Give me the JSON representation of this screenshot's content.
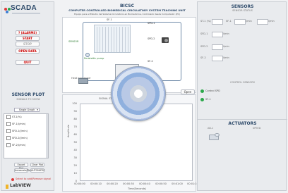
{
  "app": {
    "logo_text": "SCADA",
    "title_short": "BICSC",
    "title_main": "COMPUTER CONTROLLED BIOMEDICAL CIRCULATORY SYSTEM TEACHING UNIT",
    "title_sub": "Equipo para el Estudio del Sistema Circulatorio en Biomedicina, Controlado desde Computador (PC)"
  },
  "left_panel": {
    "buttons": [
      "? (ALARMS)",
      "START",
      "STOP",
      "OPEN DATA",
      "QUIT"
    ],
    "sensor_plot_title": "SENSOR PLOT",
    "sensor_plot_sub": "SIGNALS TO SHOW",
    "select_value": "Single Graph",
    "legend": [
      "ST-1(%)",
      "SF-1(l/min)",
      "SFD-1(l/min)",
      "SFD-2(l/min)",
      "SF-2(l/min)"
    ],
    "bottom_buttons": [
      "Export Plot",
      "Clear Plot",
      "Autoscale/Plot",
      "AUTOMATIC"
    ],
    "status_text": "Select to add/Remove signal",
    "labview_logo": "LabVIEW"
  },
  "diagram": {
    "labels": [
      "SF-1",
      "SENSOR",
      "SPD-1",
      "SPD-2",
      "Peristaltic pump",
      "Heat exchanger",
      "SF-2"
    ],
    "open_button": "Open"
  },
  "plot": {
    "title": "SIGNAL ST-1(%)",
    "ylabel": "Amplitude",
    "xlabel": "Time(Seconds)",
    "y_ticks": [
      "100",
      "90",
      "80",
      "70",
      "60",
      "50",
      "40",
      "30",
      "20",
      "10",
      "0"
    ],
    "x_ticks": [
      "00:00:00",
      "00:00:10",
      "00:00:20",
      "00:00:30",
      "00:00:40",
      "00:00:50",
      "00:01:00",
      "00:01:10"
    ]
  },
  "right_panel": {
    "sensors_title": "SENSORS",
    "sensors_sub": "SENSOR STATUS",
    "sensor_rows": [
      {
        "a": "ST-1 (%)",
        "b": "SF-1",
        "c": "l/min",
        "d": "l/min"
      },
      {
        "a": "SFD-1",
        "b": "l/min"
      },
      {
        "a": "SFD-2",
        "b": "l/min"
      },
      {
        "a": "SF-2",
        "b": "l/min"
      }
    ],
    "control_title": "CONTROL SENSORS",
    "control_items": [
      "Control SPD",
      "SF-1"
    ],
    "actuators_title": "ACTUATORS",
    "actuators_sub": [
      "AB-1",
      "SPEED"
    ],
    "colors": {
      "red": "#e03a3a",
      "green": "#2ca84b",
      "blue": "#3d7fd4"
    }
  }
}
